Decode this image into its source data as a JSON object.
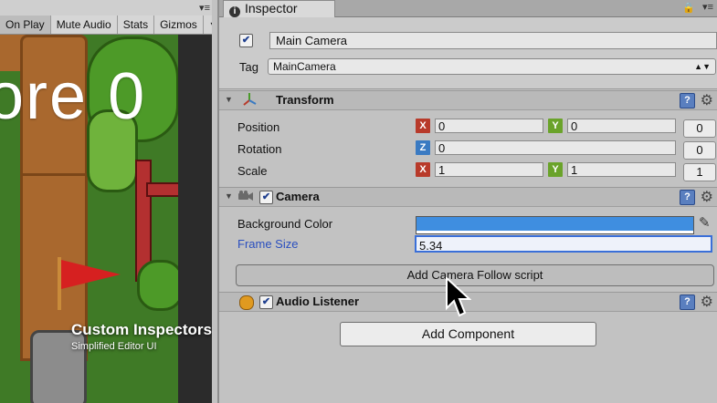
{
  "game_view": {
    "toolbar": [
      "On Play",
      "Mute Audio",
      "Stats",
      "Gizmos"
    ],
    "gizmos_arrow": "▼",
    "menu_icon": "menu-icon",
    "score_text": "ore 0",
    "caption_title": "Custom Inspectors for all scripts",
    "caption_subtitle": "Simplified Editor UI"
  },
  "inspector": {
    "tab_label": "Inspector",
    "gameobject": {
      "active": true,
      "name": "Main Camera",
      "tag_label": "Tag",
      "tag_value": "MainCamera"
    },
    "transform": {
      "title": "Transform",
      "position_label": "Position",
      "rotation_label": "Rotation",
      "scale_label": "Scale",
      "position": {
        "x": "0",
        "y": "0",
        "reset": "0"
      },
      "rotation": {
        "z": "0",
        "reset": "0"
      },
      "scale": {
        "x": "1",
        "y": "1",
        "reset": "1"
      }
    },
    "camera": {
      "title": "Camera",
      "enabled": true,
      "background_label": "Background Color",
      "background_color": "#3f8ee0",
      "frame_label": "Frame Size",
      "frame_value": "5.34",
      "follow_button": "Add Camera Follow script"
    },
    "audio_listener": {
      "title": "Audio Listener",
      "enabled": true
    },
    "add_component": "Add Component"
  },
  "axis_letters": {
    "x": "X",
    "y": "Y",
    "z": "Z"
  },
  "colors": {
    "axis_x": "#b83a2a",
    "axis_y": "#6aa32a",
    "axis_z": "#3a7ac2",
    "highlight": "#3a6fd8"
  }
}
